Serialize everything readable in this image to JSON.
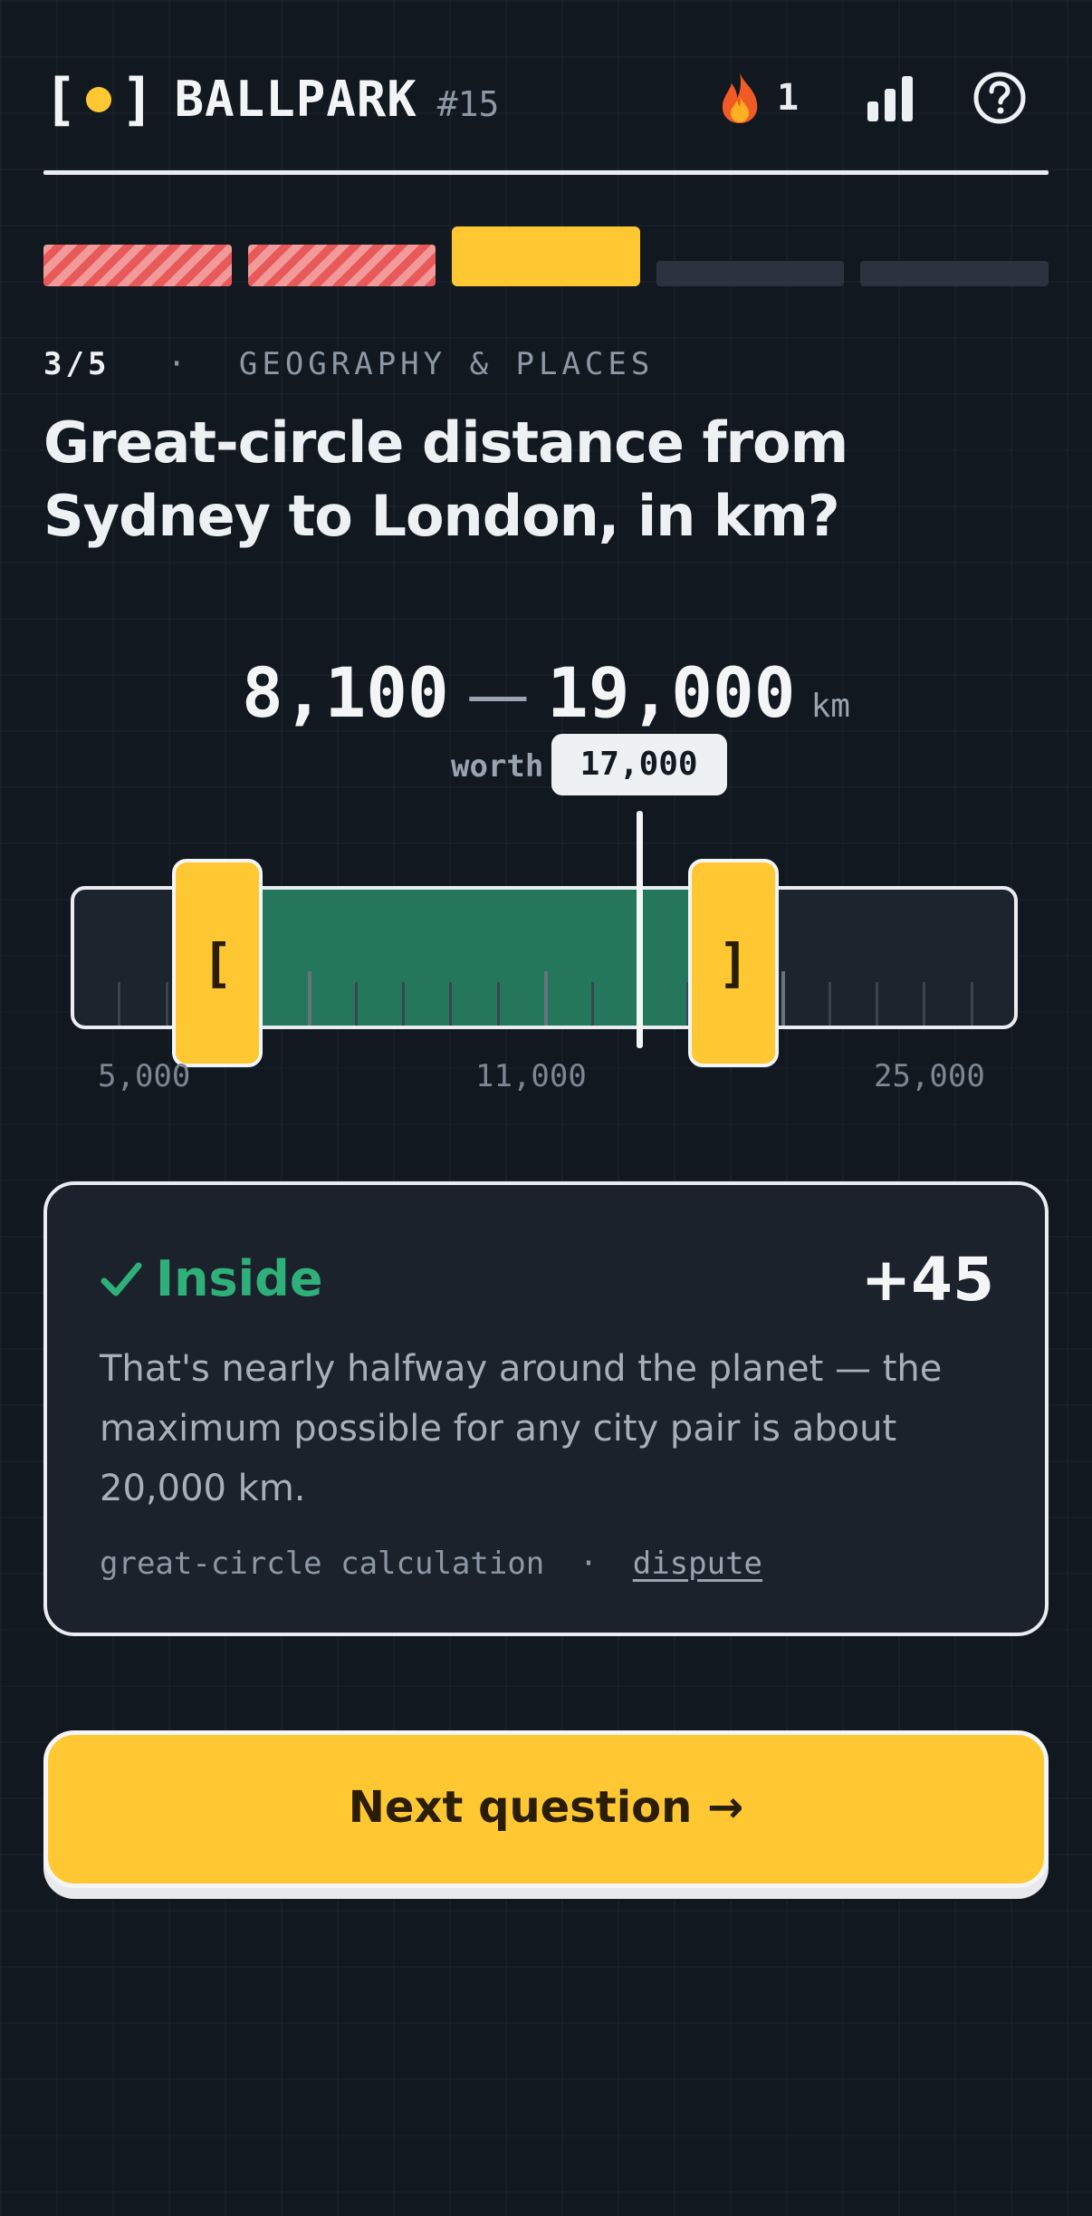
{
  "header": {
    "logo_left": "[",
    "logo_right": "]",
    "brand": "BALLPARK",
    "puzzle_number": "#15",
    "streak_count": "1",
    "icons": {
      "streak": "flame-icon",
      "stats": "bar-chart-icon",
      "help": "help-circle-icon"
    }
  },
  "progress": {
    "total": 5,
    "current": 3,
    "segments": [
      "miss",
      "miss",
      "current",
      "future",
      "future"
    ]
  },
  "question": {
    "counter": "3/5",
    "separator": "·",
    "category": "GEOGRAPHY & PLACES",
    "title": "Great-circle distance from Sydney to London, in km?"
  },
  "guess": {
    "low": "8,100",
    "dash": "—",
    "high": "19,000",
    "unit": "km",
    "worth": "worth +45",
    "low_value": 8100,
    "high_value": 19000,
    "answer_value": 17000,
    "answer_label": "17,000",
    "handle_left": "[",
    "handle_right": "]"
  },
  "slider": {
    "min": 5000,
    "max": 25000,
    "axis_labels": [
      "5,000",
      "11,000",
      "25,000"
    ],
    "fill_color": "#24775a",
    "handle_color": "#ffc833"
  },
  "result": {
    "verdict": "Inside",
    "score": "+45",
    "explanation": "That's nearly halfway around the planet — the maximum possible for any city pair is about 20,000 km.",
    "source": "great-circle calculation",
    "separator": "·",
    "dispute_label": "dispute",
    "verdict_color": "#2fb07a"
  },
  "next_button": {
    "label": "Next question →"
  },
  "colors": {
    "accent": "#ffc833",
    "miss": "#e85a5a",
    "background": "#111820"
  }
}
